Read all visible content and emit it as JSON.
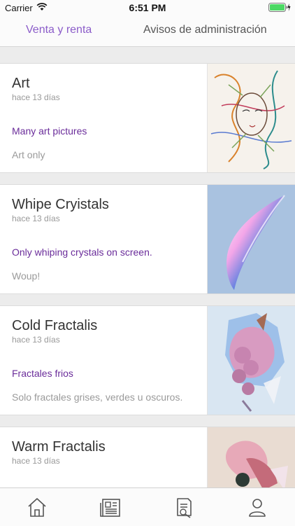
{
  "status_bar": {
    "carrier": "Carrier",
    "time": "6:51 PM"
  },
  "tabs": [
    {
      "label": "Venta y renta",
      "active": true
    },
    {
      "label": "Avisos de administración",
      "active": false
    }
  ],
  "listings": [
    {
      "title": "Art",
      "date": "hace 13 días",
      "subtitle": "Many art pictures",
      "description": "Art only"
    },
    {
      "title": "Whipe Cryistals",
      "date": "hace 13 días",
      "subtitle": "Only whiping crystals on screen.",
      "description": "Woup!"
    },
    {
      "title": "Cold Fractalis",
      "date": "hace 13 días",
      "subtitle": "Fractales frios",
      "description": "Solo fractales grises, verdes u oscuros."
    },
    {
      "title": "Warm Fractalis",
      "date": "hace 13 días",
      "subtitle": "",
      "description": ""
    }
  ],
  "tab_bar": [
    "home-icon",
    "newspaper-icon",
    "document-icon",
    "profile-icon"
  ],
  "colors": {
    "accent": "#8b5cc9",
    "subtitle": "#6a2c9a",
    "battery": "#4cd964"
  }
}
